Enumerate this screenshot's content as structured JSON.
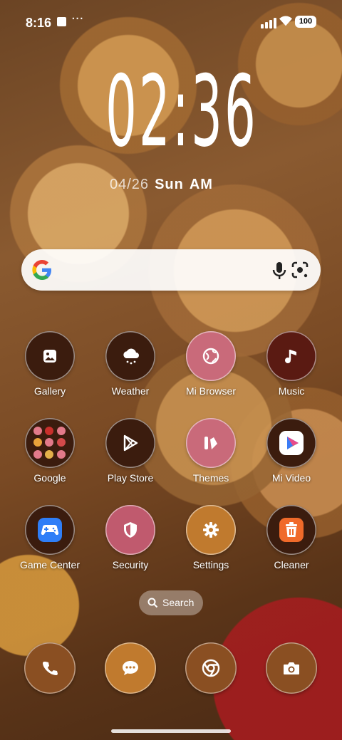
{
  "status_bar": {
    "time": "8:16",
    "overflow": "···",
    "battery": "100"
  },
  "lock_clock": {
    "time": "02:36",
    "date": "04/26",
    "day": "Sun",
    "ampm": "AM"
  },
  "search_widget": {
    "logo": "google-g-icon",
    "mic": "mic-icon",
    "lens": "lens-icon"
  },
  "apps": [
    {
      "label": "Gallery",
      "icon": "gallery-icon",
      "color": "#3b1c0e"
    },
    {
      "label": "Weather",
      "icon": "weather-icon",
      "color": "#3b1c0e"
    },
    {
      "label": "Mi Browser",
      "icon": "globe-icon",
      "color": "#c96a7a"
    },
    {
      "label": "Music",
      "icon": "music-note-icon",
      "color": "#5a1a12"
    },
    {
      "label": "Google",
      "icon": "folder-icon",
      "color": "#3b1c0e"
    },
    {
      "label": "Play Store",
      "icon": "play-store-icon",
      "color": "#3b1c0e"
    },
    {
      "label": "Themes",
      "icon": "themes-icon",
      "color": "#c96a7a"
    },
    {
      "label": "Mi Video",
      "icon": "mi-video-icon",
      "color": "#3b1c0e"
    },
    {
      "label": "Game Center",
      "icon": "gamepad-icon",
      "color": "#3b1c0e"
    },
    {
      "label": "Security",
      "icon": "shield-icon",
      "color": "#c05a6e"
    },
    {
      "label": "Settings",
      "icon": "gear-icon",
      "color": "#c07a2e"
    },
    {
      "label": "Cleaner",
      "icon": "trash-icon",
      "color": "#3b1c0e"
    }
  ],
  "app_drawer_search": {
    "label": "Search"
  },
  "dock": [
    {
      "icon": "phone-icon",
      "color": "#8a4f22"
    },
    {
      "icon": "messages-icon",
      "color": "#c07a2e"
    },
    {
      "icon": "chrome-icon",
      "color": "#8a4f22"
    },
    {
      "icon": "camera-icon",
      "color": "#8a4f22"
    }
  ]
}
